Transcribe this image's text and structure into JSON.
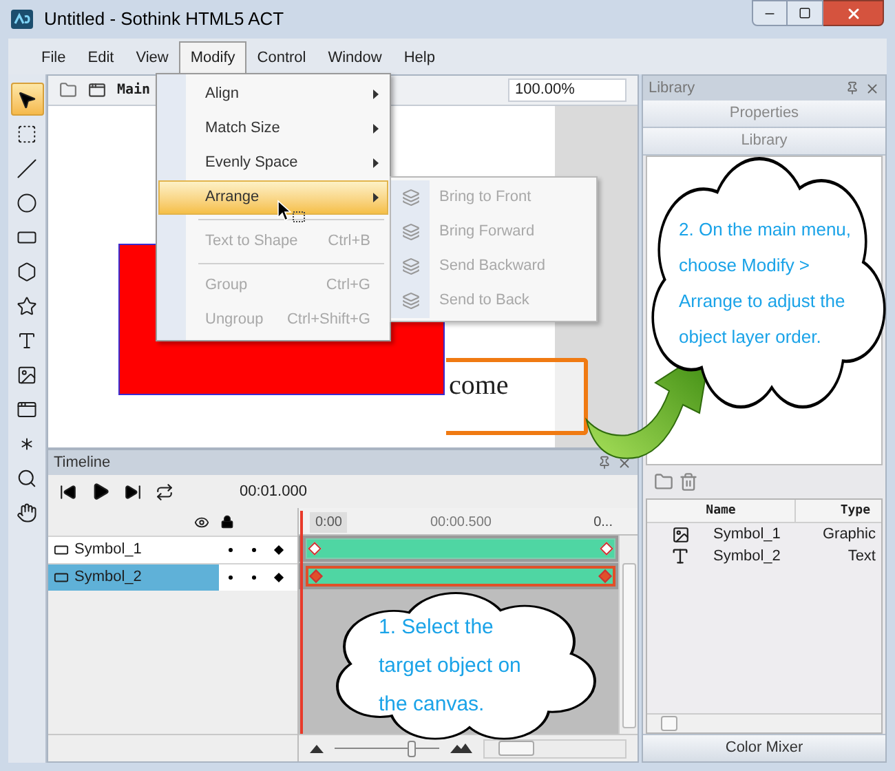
{
  "window": {
    "title": "Untitled - Sothink HTML5 ACT"
  },
  "menu_bar": [
    {
      "label": "File",
      "selected": false
    },
    {
      "label": "Edit",
      "selected": false
    },
    {
      "label": "View",
      "selected": false
    },
    {
      "label": "Modify",
      "selected": true
    },
    {
      "label": "Control",
      "selected": false
    },
    {
      "label": "Window",
      "selected": false
    },
    {
      "label": "Help",
      "selected": false
    }
  ],
  "modify_menu": [
    {
      "kind": "submenu",
      "label": "Align",
      "disabled": false,
      "selected": false
    },
    {
      "kind": "submenu",
      "label": "Match Size",
      "disabled": false,
      "selected": false
    },
    {
      "kind": "submenu",
      "label": "Evenly Space",
      "disabled": false,
      "selected": false
    },
    {
      "kind": "submenu",
      "label": "Arrange",
      "disabled": false,
      "selected": true
    },
    {
      "kind": "separator"
    },
    {
      "kind": "command",
      "label": "Text to Shape",
      "shortcut": "Ctrl+B",
      "disabled": true,
      "selected": false
    },
    {
      "kind": "separator"
    },
    {
      "kind": "command",
      "label": "Group",
      "shortcut": "Ctrl+G",
      "disabled": true,
      "selected": false
    },
    {
      "kind": "command",
      "label": "Ungroup",
      "shortcut": "Ctrl+Shift+G",
      "disabled": true,
      "selected": false
    }
  ],
  "arrange_submenu": [
    {
      "label": "Bring to Front",
      "disabled": true
    },
    {
      "label": "Bring Forward",
      "disabled": true
    },
    {
      "label": "Send Backward",
      "disabled": true
    },
    {
      "label": "Send to Back",
      "disabled": true
    }
  ],
  "tools": [
    {
      "kind": "arrow",
      "selected": true
    },
    {
      "kind": "transform",
      "selected": false
    },
    {
      "kind": "line",
      "selected": false
    },
    {
      "kind": "oval",
      "selected": false
    },
    {
      "kind": "rectangle",
      "selected": false
    },
    {
      "kind": "polygon",
      "selected": false
    },
    {
      "kind": "star",
      "selected": false
    },
    {
      "kind": "text",
      "selected": false
    },
    {
      "kind": "image",
      "selected": false
    },
    {
      "kind": "frame",
      "selected": false
    },
    {
      "kind": "burst",
      "selected": false
    },
    {
      "kind": "zoom",
      "selected": false
    },
    {
      "kind": "hand",
      "selected": false
    }
  ],
  "stage": {
    "breadcrumb": "Main",
    "zoom": "100.00%",
    "text_object": "come"
  },
  "timeline": {
    "title": "Timeline",
    "time": "00:01.000",
    "ruler_labels": [
      "0:00",
      "00:00.500",
      "0..."
    ],
    "layers": [
      {
        "name": "Symbol_1",
        "selected": false
      },
      {
        "name": "Symbol_2",
        "selected": true
      }
    ],
    "zoom_slider": {
      "level": 0.75
    }
  },
  "library_panel": {
    "title": "Library",
    "tabs": [
      "Properties",
      "Library"
    ],
    "columns": [
      "Name",
      "Type"
    ],
    "rows": [
      {
        "kind": "graphic",
        "name": "Symbol_1",
        "type": "Graphic"
      },
      {
        "kind": "text",
        "name": "Symbol_2",
        "type": "Text"
      }
    ],
    "footer": "Color Mixer"
  },
  "callouts": [
    {
      "text": "1. Select the target object on the canvas."
    },
    {
      "text": "2. On the main menu, choose Modify > Arrange to adjust the object layer order."
    }
  ]
}
